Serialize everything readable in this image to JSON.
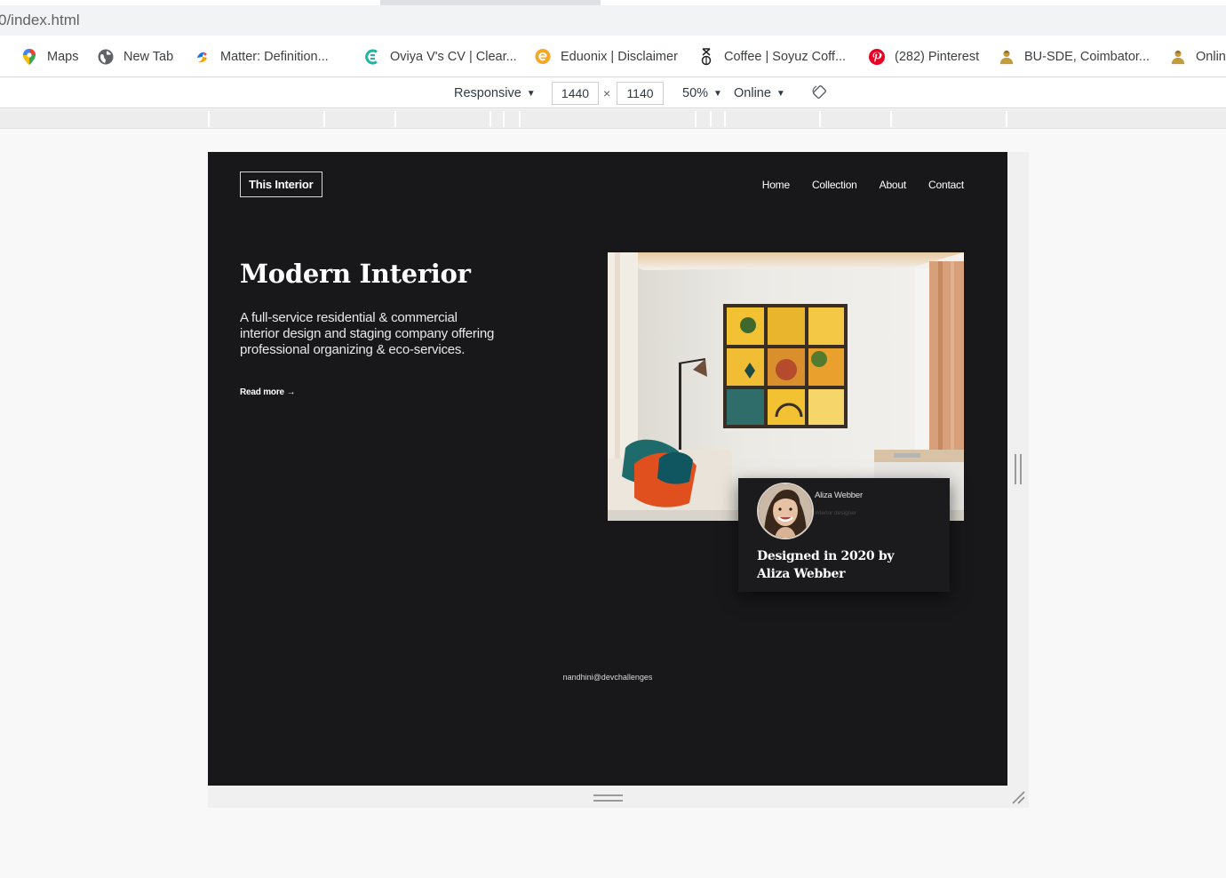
{
  "browser": {
    "url": "0/index.html",
    "bookmarks": [
      {
        "label": "Maps",
        "icon": "maps-pin-icon"
      },
      {
        "label": "New Tab",
        "icon": "globe-icon"
      },
      {
        "label": "Matter: Definition...",
        "icon": "matter-site-icon"
      },
      {
        "label": "Oviya V's CV | Clear...",
        "icon": "clearcv-icon"
      },
      {
        "label": "Eduonix | Disclaimer",
        "icon": "eduonix-icon"
      },
      {
        "label": "Coffee | Soyuz Coff...",
        "icon": "soyuz-coffee-icon"
      },
      {
        "label": "(282) Pinterest",
        "icon": "pinterest-icon"
      },
      {
        "label": "BU-SDE, Coimbator...",
        "icon": "bu-sde-icon"
      },
      {
        "label": "Onlin",
        "icon": "bu-sde-icon"
      }
    ]
  },
  "devtools": {
    "device": "Responsive",
    "width": "1440",
    "times": "×",
    "height": "1140",
    "zoom": "50%",
    "throttle": "Online",
    "caret": "▼"
  },
  "site": {
    "logo": "This Interior",
    "nav": [
      "Home",
      "Collection",
      "About",
      "Contact"
    ],
    "hero": {
      "title": "Modern Interior",
      "text": "A full-service residential & commercial interior design and staging company offering professional organizing & eco-services.",
      "cta": "Read more →"
    },
    "card": {
      "name": "Aliza Webber",
      "role": "Interior designer",
      "title": "Designed in 2020 by Aliza Webber"
    },
    "credit": "nandhini@devchallenges"
  },
  "colors": {
    "site_bg": "#18181b",
    "card_bg": "#1b1b1e",
    "accent_yellow": "#f2c233",
    "accent_orange": "#e0501f",
    "accent_teal": "#1f6b6b"
  }
}
